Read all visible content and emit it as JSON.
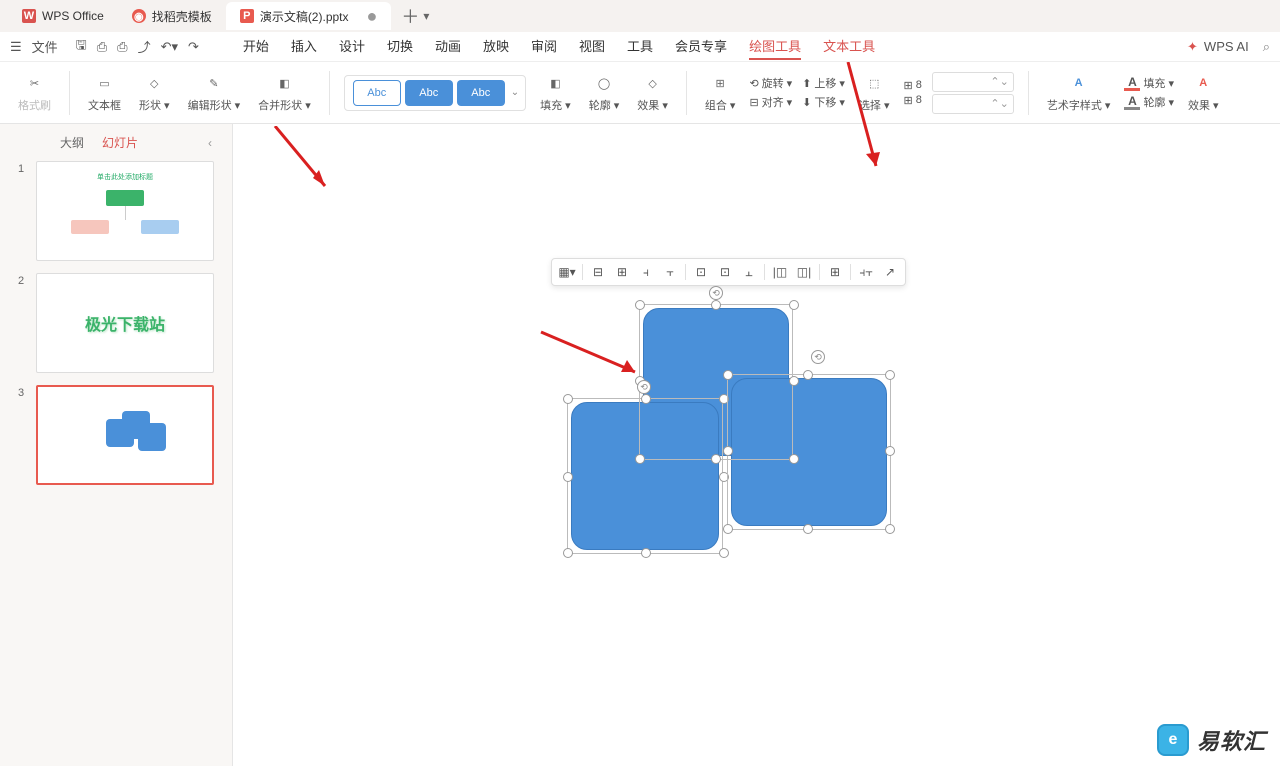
{
  "titlebar": {
    "tabs": [
      {
        "icon": "W",
        "label": "WPS Office"
      },
      {
        "icon": "◉",
        "label": "找稻壳模板"
      },
      {
        "icon": "P",
        "label": "演示文稿(2).pptx"
      }
    ],
    "add": "＋",
    "dropdown": "▾"
  },
  "qat": {
    "menu": "文件",
    "items": [
      "☰",
      "⎙",
      "⏷",
      "⎌",
      "↻"
    ]
  },
  "menu": {
    "tabs": [
      "开始",
      "插入",
      "设计",
      "切换",
      "动画",
      "放映",
      "审阅",
      "视图",
      "工具",
      "会员专享",
      "绘图工具",
      "文本工具"
    ],
    "active_index": 10,
    "ai": "WPS AI"
  },
  "ribbon": {
    "format_painter": "格式刷",
    "textbox": "文本框",
    "shape": "形状",
    "edit_shape": "编辑形状",
    "merge_shape": "合并形状",
    "preset_label": "Abc",
    "fill": "填充",
    "outline": "轮廓",
    "effect": "效果",
    "group": "组合",
    "rotate": "旋转",
    "align": "对齐",
    "move_up": "上移",
    "move_down": "下移",
    "select": "选择",
    "art_style": "艺术字样式",
    "text_fill": "填充",
    "text_outline": "轮廓",
    "text_effect": "效果",
    "eight": "8"
  },
  "sidebar": {
    "tab_outline": "大纲",
    "tab_slides": "幻灯片",
    "slides": [
      "1",
      "2",
      "3"
    ],
    "thumb1_title": "单击此处添加标题",
    "thumb2_text": "极光下载站"
  },
  "float_toolbar": {
    "buttons": [
      "▦▾",
      "⊟",
      "⊞",
      "⫞",
      "⫟",
      "⊡",
      "⊡",
      "⫠",
      "|◫",
      "◫|",
      "⊞",
      "⫞⫟",
      "↗"
    ]
  },
  "watermark": {
    "icon": "e",
    "text": "易软汇"
  }
}
